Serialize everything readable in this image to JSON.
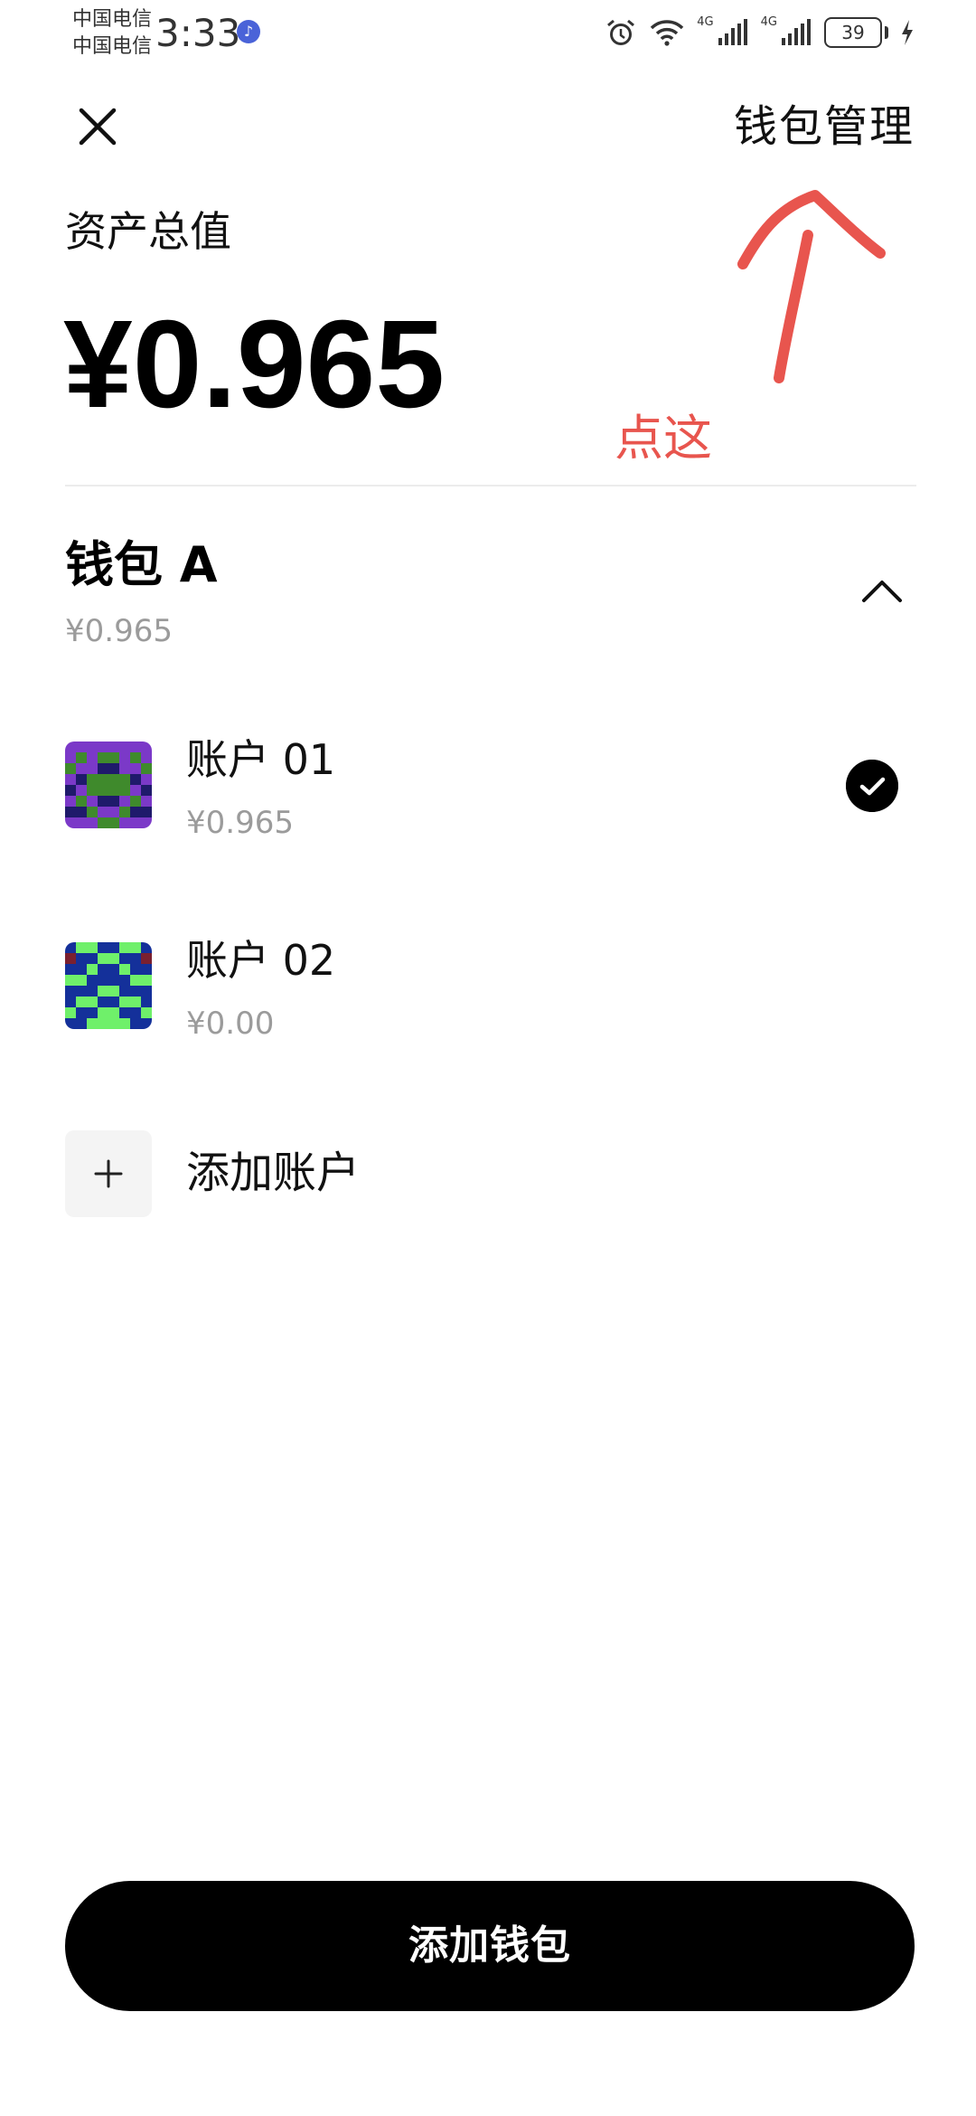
{
  "status_bar": {
    "carrier_1": "中国电信",
    "carrier_2": "中国电信",
    "time": "3:33",
    "network_1": "4G",
    "network_2": "4G",
    "battery": "39",
    "icons": [
      "music-icon",
      "alarm-icon",
      "wifi-icon",
      "signal-icon",
      "battery-icon",
      "charging-icon"
    ]
  },
  "header": {
    "close_icon": "close-icon",
    "manage_label": "钱包管理"
  },
  "summary": {
    "label": "资产总值",
    "value": "¥0.965"
  },
  "annotation": {
    "text": "点这",
    "color": "#e8554e"
  },
  "wallet": {
    "name": "钱包 A",
    "balance": "¥0.965",
    "expanded": true,
    "accounts": [
      {
        "name": "账户 01",
        "balance": "¥0.965",
        "selected": true
      },
      {
        "name": "账户 02",
        "balance": "¥0.00",
        "selected": false
      }
    ],
    "add_account_label": "添加账户"
  },
  "footer": {
    "add_wallet_label": "添加钱包"
  },
  "colors": {
    "accent": "#000000",
    "muted_text": "#9b9b9b",
    "annotation": "#e8554e"
  }
}
